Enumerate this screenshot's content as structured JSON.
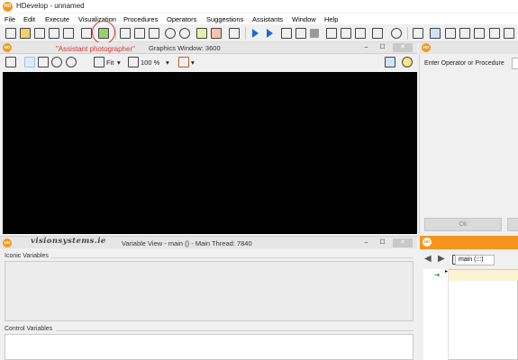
{
  "app": {
    "logo": "HD",
    "title": "HDevelop - unnamed"
  },
  "menu": [
    "File",
    "Edit",
    "Execute",
    "Visualization",
    "Procedures",
    "Operators",
    "Suggestions",
    "Assistants",
    "Window",
    "Help"
  ],
  "toolbar": {
    "icons": [
      "new-file-icon",
      "open-file-icon",
      "save-icon",
      "save-all-icon",
      "print-icon",
      "properties-icon",
      "assistant-photographer-icon",
      "cut-icon",
      "copy-icon",
      "paste-icon",
      "undo-icon",
      "redo-icon",
      "insert-icon",
      "append-icon",
      "run-icon",
      "step-over-icon",
      "step-into-icon",
      "step-out-icon",
      "stop-icon",
      "reset-icon",
      "breakpoint-icon",
      "profile-icon",
      "clock-icon",
      "graphics-icon",
      "histogram-icon",
      "line-profile-icon",
      "region-info-icon",
      "feature-icon",
      "ocr-icon"
    ]
  },
  "annotation": "\"Assistant photographer\"",
  "graphics_window": {
    "title": "Graphics Window: 3600",
    "fit_label": "Fit",
    "zoom_label": "100 %"
  },
  "operator_panel": {
    "prompt": "Enter Operator or Procedure",
    "ok_label": "Ok"
  },
  "variable_view": {
    "watermark": "visionsystems.ie",
    "title": "Variable View - main () - Main Thread: 7840",
    "iconic_label": "Iconic Variables",
    "control_label": "Control Variables"
  },
  "program_window": {
    "procedure": "main (:::)"
  },
  "window_controls": {
    "minimize": "–",
    "maximize": "☐",
    "close": "✕"
  },
  "colors": {
    "accent": "#f7941d",
    "annotation": "#d9383a",
    "canvas": "#000000",
    "run_arrow": "#1a6bd6"
  }
}
